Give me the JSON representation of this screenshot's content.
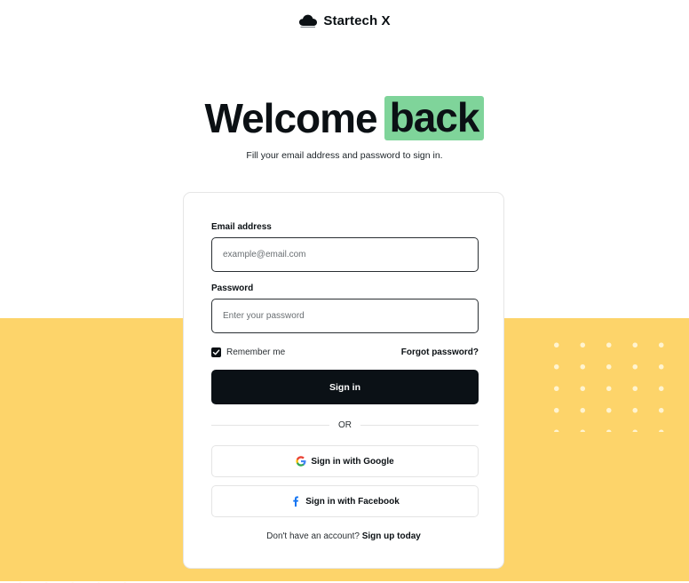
{
  "brand": {
    "name": "Startech X",
    "logo_icon": "cloud-icon"
  },
  "hero": {
    "title_start": "Welcome",
    "title_highlight": "back",
    "subtitle": "Fill your email address and password to sign in."
  },
  "form": {
    "email_label": "Email address",
    "email_placeholder": "example@email.com",
    "email_value": "",
    "password_label": "Password",
    "password_placeholder": "Enter your password",
    "password_value": "",
    "remember_label": "Remember me",
    "remember_checked": true,
    "forgot_link": "Forgot password?",
    "signin_label": "Sign in",
    "divider_text": "OR",
    "google_label": "Sign in with Google",
    "facebook_label": "Sign in with Facebook",
    "signup_prompt": "Don't have an account?",
    "signup_link": "Sign up today"
  },
  "colors": {
    "accent_yellow": "#fdd46a",
    "highlight_green": "#7fd49a",
    "primary_dark": "#0b1116",
    "facebook_blue": "#1877f2"
  }
}
